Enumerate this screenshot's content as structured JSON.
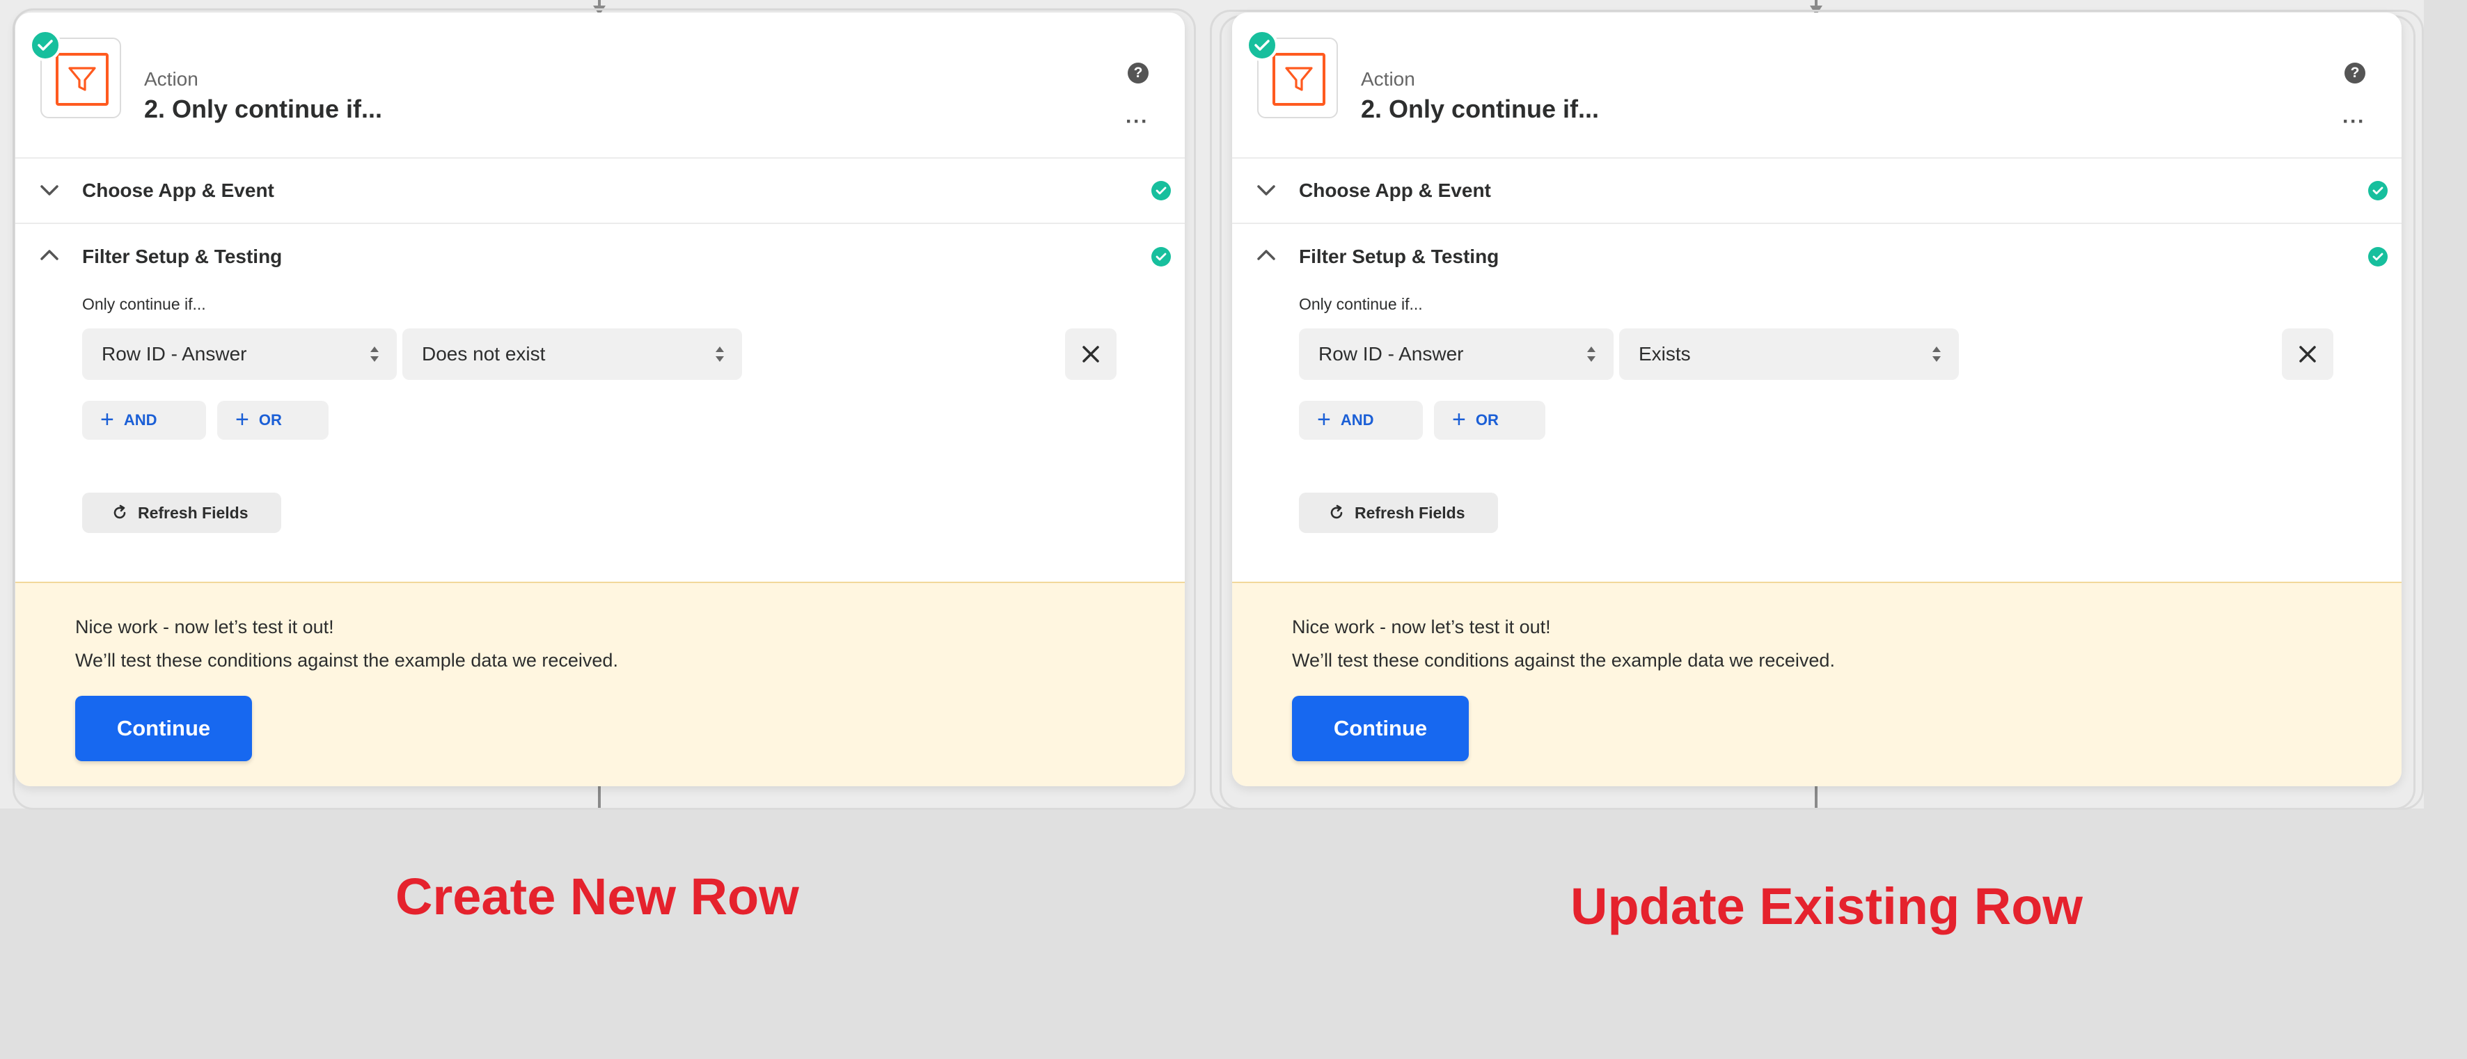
{
  "panels": [
    {
      "header": {
        "label": "Action",
        "title": "2. Only continue if..."
      },
      "sections": {
        "choose_app": "Choose App & Event",
        "filter_setup": "Filter Setup & Testing"
      },
      "filter": {
        "intro": "Only continue if...",
        "field_value": "Row ID - Answer",
        "condition_value": "Does not exist",
        "and_label": "AND",
        "or_label": "OR",
        "refresh_label": "Refresh Fields"
      },
      "test": {
        "line1": "Nice work - now let’s test it out!",
        "line2": "We’ll test these conditions against the example data we received.",
        "continue_label": "Continue"
      },
      "caption": "Create New Row"
    },
    {
      "header": {
        "label": "Action",
        "title": "2. Only continue if..."
      },
      "sections": {
        "choose_app": "Choose App & Event",
        "filter_setup": "Filter Setup & Testing"
      },
      "filter": {
        "intro": "Only continue if...",
        "field_value": "Row ID - Answer",
        "condition_value": "Exists",
        "and_label": "AND",
        "or_label": "OR",
        "refresh_label": "Refresh Fields"
      },
      "test": {
        "line1": "Nice work - now let’s test it out!",
        "line2": "We’ll test these conditions against the example data we received.",
        "continue_label": "Continue"
      },
      "caption": "Update Existing Row"
    }
  ],
  "icons": {
    "app": "filter-funnel-icon",
    "status": "check-icon",
    "help": "help-icon",
    "more": "more-options-icon",
    "collapse": "chevron-down-icon",
    "expand": "chevron-up-icon",
    "remove": "close-icon",
    "add": "plus-icon",
    "refresh": "refresh-icon",
    "select": "select-updown-icon"
  },
  "colors": {
    "success": "#17bf9d",
    "brand_orange": "#ff5a1f",
    "primary_blue": "#1768f0",
    "link_blue": "#1b5fd6",
    "caption_red": "#e5222d",
    "test_panel_bg": "#fff6e0"
  }
}
